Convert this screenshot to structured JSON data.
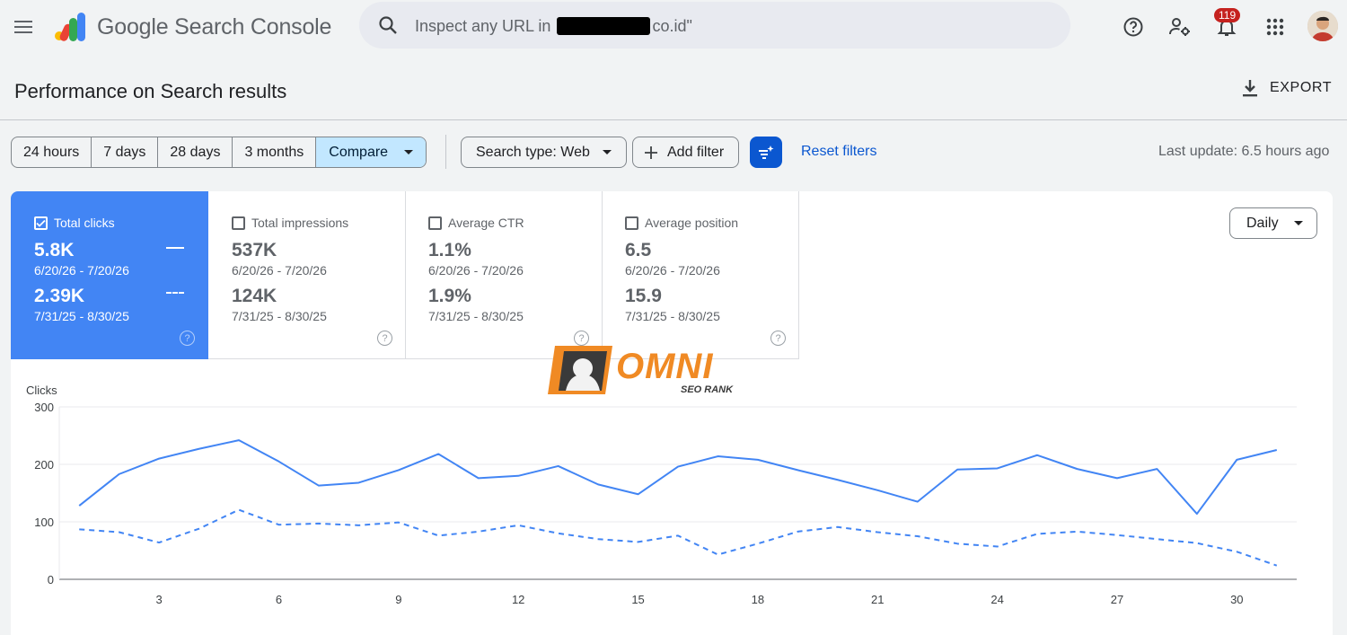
{
  "app": {
    "title": "Google Search Console",
    "search_prefix": "Inspect any URL in",
    "search_suffix": "co.id\"",
    "notification_count": "119"
  },
  "page": {
    "title": "Performance on Search results",
    "export_label": "EXPORT"
  },
  "filters": {
    "ranges": [
      "24 hours",
      "7 days",
      "28 days",
      "3 months"
    ],
    "compare_label": "Compare",
    "search_type_label": "Search type: Web",
    "add_filter_label": "Add filter",
    "reset_label": "Reset filters",
    "last_update": "Last update: 6.5 hours ago"
  },
  "metrics": {
    "clicks": {
      "label": "Total clicks",
      "value1": "5.8K",
      "range1": "6/20/26 - 7/20/26",
      "value2": "2.39K",
      "range2": "7/31/25 - 8/30/25",
      "checked": true
    },
    "impressions": {
      "label": "Total impressions",
      "value1": "537K",
      "range1": "6/20/26 - 7/20/26",
      "value2": "124K",
      "range2": "7/31/25 - 8/30/25",
      "checked": false
    },
    "ctr": {
      "label": "Average CTR",
      "value1": "1.1%",
      "range1": "6/20/26 - 7/20/26",
      "value2": "1.9%",
      "range2": "7/31/25 - 8/30/25",
      "checked": false
    },
    "position": {
      "label": "Average position",
      "value1": "6.5",
      "range1": "6/20/26 - 7/20/26",
      "value2": "15.9",
      "range2": "7/31/25 - 8/30/25",
      "checked": false
    }
  },
  "granularity": "Daily",
  "watermark": {
    "brand": "OMNI",
    "tagline": "SEO RANK"
  },
  "colors": {
    "accent": "#4285f4",
    "primary_button": "#0b57d0",
    "badge": "#c5221f"
  },
  "chart_data": {
    "type": "line",
    "ylabel": "Clicks",
    "ylim": [
      0,
      300
    ],
    "yticks": [
      0,
      100,
      200,
      300
    ],
    "xticks": [
      3,
      6,
      9,
      12,
      15,
      18,
      21,
      24,
      27,
      30
    ],
    "x": [
      1,
      2,
      3,
      4,
      5,
      6,
      7,
      8,
      9,
      10,
      11,
      12,
      13,
      14,
      15,
      16,
      17,
      18,
      19,
      20,
      21,
      22,
      23,
      24,
      25,
      26,
      27,
      28,
      29,
      30,
      31
    ],
    "series": [
      {
        "style": "solid",
        "values": [
          128,
          183,
          210,
          227,
          242,
          205,
          163,
          168,
          190,
          218,
          176,
          180,
          197,
          165,
          148,
          196,
          214,
          208,
          190,
          173,
          155,
          135,
          191,
          193,
          216,
          192,
          176,
          192,
          114,
          208,
          225
        ]
      },
      {
        "style": "dashed",
        "values": [
          87,
          82,
          64,
          88,
          121,
          95,
          97,
          94,
          99,
          76,
          83,
          94,
          80,
          70,
          65,
          76,
          43,
          62,
          83,
          91,
          82,
          75,
          62,
          57,
          79,
          83,
          77,
          70,
          63,
          48,
          24
        ]
      }
    ]
  }
}
